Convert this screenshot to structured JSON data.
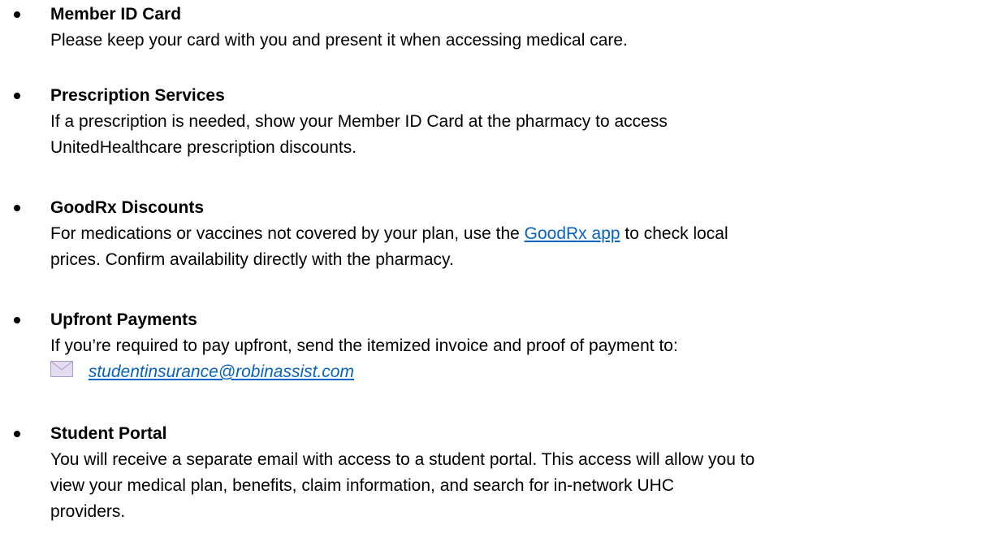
{
  "items": [
    {
      "title": "Member ID Card",
      "lines": [
        "Please keep your card with you and present it when accessing medical care."
      ]
    },
    {
      "title": "Prescription Services",
      "lines": [
        "If a prescription is needed, show your Member ID Card at the pharmacy to access",
        "UnitedHealthcare prescription discounts."
      ]
    },
    {
      "title": "GoodRx Discounts",
      "line1_before": "For medications or vaccines not covered by your plan, use the ",
      "link_text": "GoodRx app",
      "line1_after": " to check local",
      "line2": "prices. Confirm availability directly with the pharmacy."
    },
    {
      "title": "Upfront Payments",
      "line1": "If you’re required to pay upfront, send the itemized invoice and proof of payment to:",
      "email": "studentinsurance@robinassist.com"
    },
    {
      "title": "Student Portal",
      "lines": [
        "You will receive a separate email with access to a student portal. This access will allow you to",
        "view your medical plan, benefits, claim information, and search for in-network UHC",
        "providers."
      ]
    }
  ],
  "colors": {
    "text": "#000000",
    "link": "#0563C1",
    "envelope_fill": "#E4DDF0",
    "envelope_stroke": "#A99BC9"
  },
  "icons": {
    "email": "envelope-icon"
  }
}
